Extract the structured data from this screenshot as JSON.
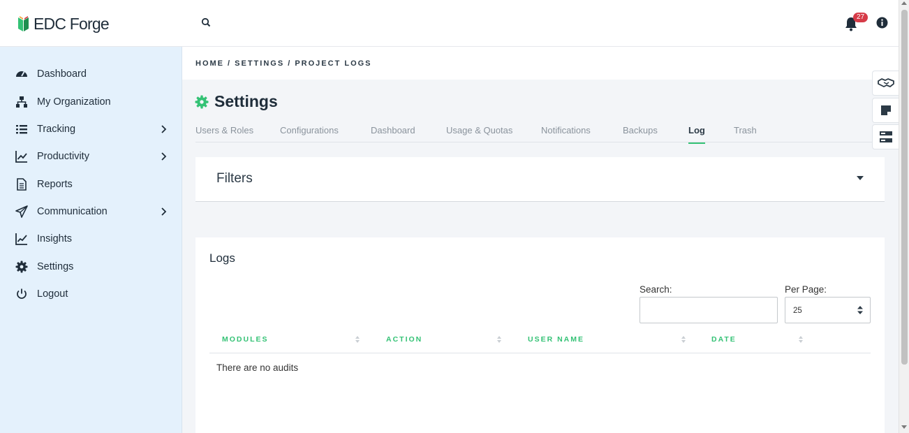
{
  "app": {
    "logo_text": "EDC Forge"
  },
  "header": {
    "notification_count": "27"
  },
  "sidebar": {
    "items": [
      {
        "label": "Dashboard"
      },
      {
        "label": "My Organization"
      },
      {
        "label": "Tracking"
      },
      {
        "label": "Productivity"
      },
      {
        "label": "Reports"
      },
      {
        "label": "Communication"
      },
      {
        "label": "Insights"
      },
      {
        "label": "Settings"
      },
      {
        "label": "Logout"
      }
    ]
  },
  "breadcrumb": "HOME / SETTINGS / PROJECT LOGS",
  "page": {
    "title": "Settings"
  },
  "tabs": [
    {
      "label": "Users & Roles"
    },
    {
      "label": "Configurations"
    },
    {
      "label": "Dashboard"
    },
    {
      "label": "Usage & Quotas"
    },
    {
      "label": "Notifications"
    },
    {
      "label": "Backups"
    },
    {
      "label": "Log",
      "active": true
    },
    {
      "label": "Trash"
    }
  ],
  "filters": {
    "title": "Filters"
  },
  "logs": {
    "title": "Logs",
    "search_label": "Search:",
    "search_value": "",
    "per_page_label": "Per Page:",
    "per_page_value": "25",
    "columns": [
      "MODULES",
      "ACTION",
      "USER NAME",
      "DATE"
    ],
    "empty_message": "There are no audits"
  },
  "colors": {
    "accent": "#34c275",
    "sidebar_bg": "#e4f1fc",
    "badge": "#d63b48"
  }
}
